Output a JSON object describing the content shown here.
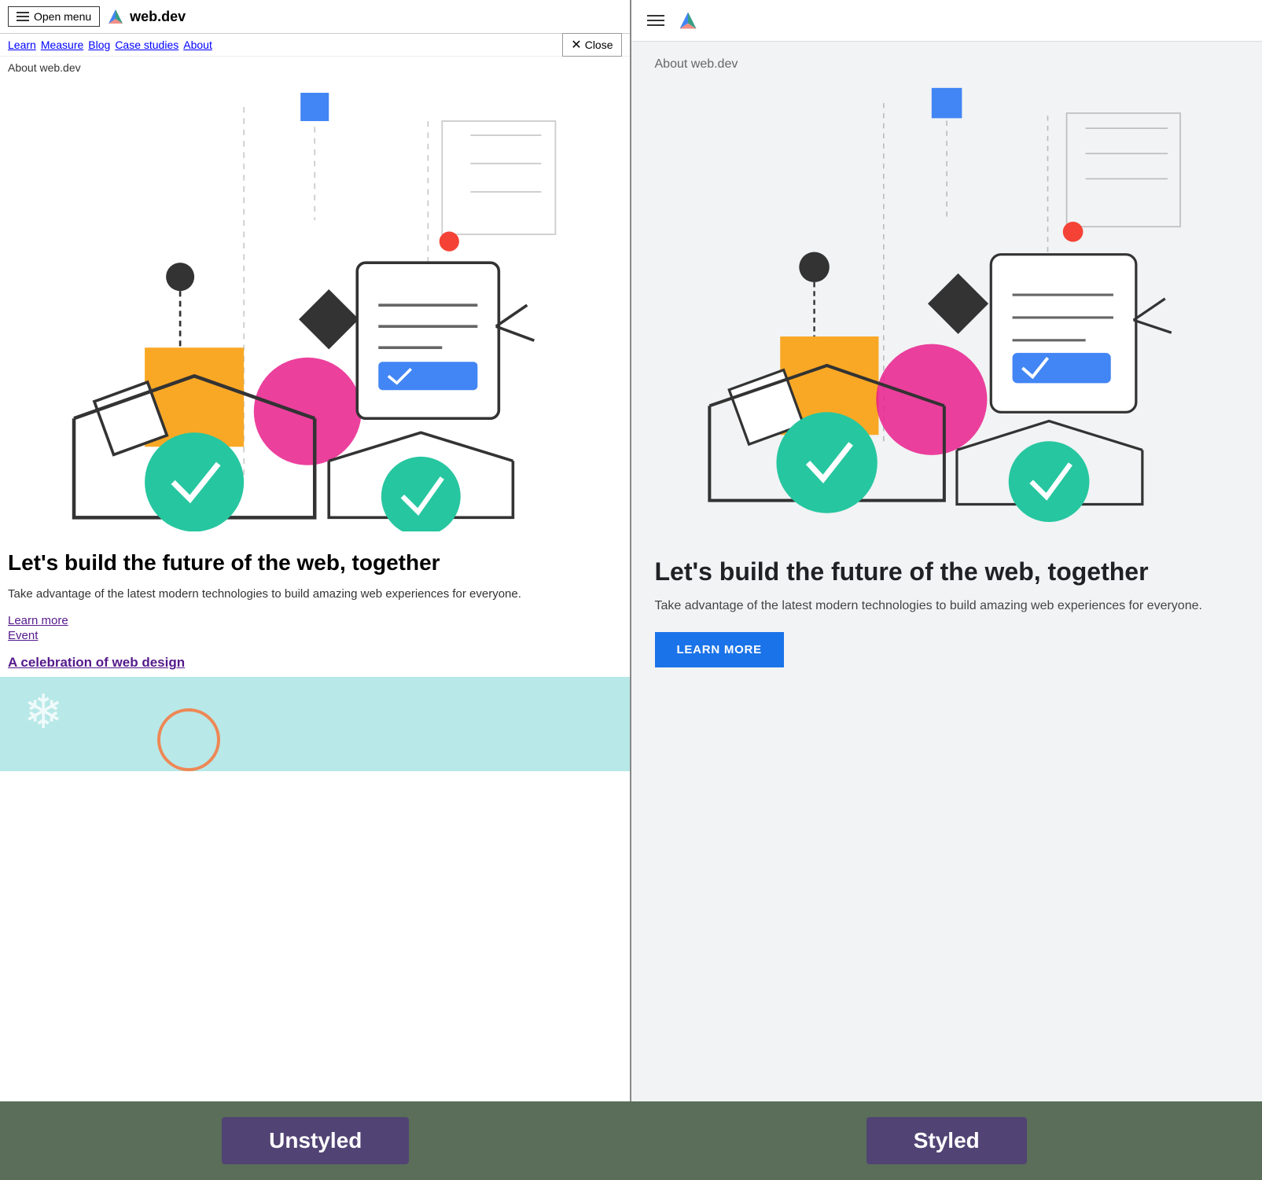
{
  "site": {
    "name": "web.dev",
    "logo_symbol": "▶"
  },
  "header_unstyled": {
    "menu_label": "Open menu",
    "close_label": "Close",
    "nav_items": [
      "Learn",
      "Measure",
      "Blog",
      "Case studies",
      "About"
    ]
  },
  "header_styled": {},
  "about_label": "About web.dev",
  "hero": {
    "title": "Let's build the future of the web, together",
    "description": "Take advantage of the latest modern technologies to build amazing web experiences for everyone.",
    "learn_more": "Learn more",
    "learn_more_styled": "LEARN MORE",
    "event_label": "Event",
    "celebration_link": "A celebration of web design"
  },
  "labels": {
    "unstyled": "Unstyled",
    "styled": "Styled"
  }
}
